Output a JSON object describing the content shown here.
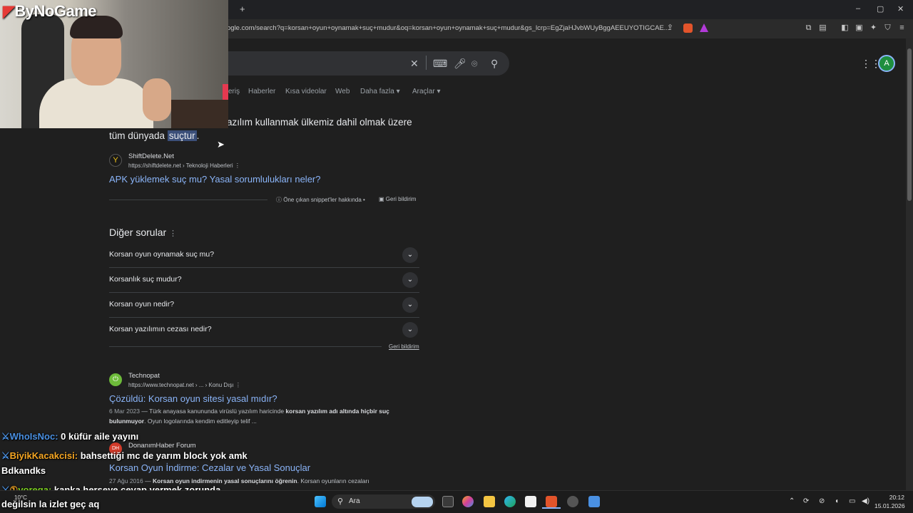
{
  "browser": {
    "new_tab": "+",
    "url": "ogle.com/search?q=korsan+oyun+oynamak+suç+mudur&oq=korsan+oyun+oynamak+suç+mudur&gs_lcrp=EgZjaHJvbWUyBggAEEUYOTIGCAE...",
    "window_controls": [
      "–",
      "▢",
      "✕"
    ]
  },
  "search": {
    "clear": "✕",
    "avatar_letter": "A"
  },
  "nav_tabs": [
    "eriş",
    "Haberler",
    "Kısa videolar",
    "Web",
    "Daha fazla",
    "Araçlar"
  ],
  "featured": {
    "line1": "azılım kullanmak ülkemiz dahil olmak üzere",
    "line2_prefix": "tüm dünyada ",
    "line2_highlight": "suçtur",
    "line2_suffix": ".",
    "source_name": "ShiftDelete.Net",
    "source_url": "https://shiftdelete.net › Teknoloji Haberleri",
    "title": "APK yüklemek suç mu? Yasal sorumlulukları neler?",
    "about": "Öne çıkan snippet'ler hakkında",
    "feedback": "Geri bildirim"
  },
  "paa": {
    "title": "Diğer sorular",
    "questions": [
      "Korsan oyun oynamak suç mu?",
      "Korsanlık suç mudur?",
      "Korsan oyun nedir?",
      "Korsan yazılımın cezası nedir?"
    ],
    "feedback": "Geri bildirim"
  },
  "results": [
    {
      "source_name": "Technopat",
      "source_url": "https://www.technopat.net › ... › Konu Dışı",
      "title": "Çözüldü: Korsan oyun sitesi yasal mıdır?",
      "date": "6 Mar 2023",
      "desc_plain": " — Türk anayasa kanununda virüslü yazılım haricinde ",
      "desc_bold": "korsan yazılım adı altında hiçbir suç bulunmuyor",
      "desc_end": ". Oyun logolarında kendim editleyip telif ..."
    },
    {
      "source_name": "DonanımHaber Forum",
      "title": "Korsan Oyun İndirme: Cezalar ve Yasal Sonuçlar",
      "date": "27 Ağu 2016",
      "desc_plain": " — ",
      "desc_bold": "Korsan oyun indirmenin yasal sonuçlarını öğrenin",
      "desc_end": ". Korsan oyunların cezaları"
    }
  ],
  "stream": {
    "logo": "ByNoGame",
    "chat": [
      {
        "user": "WhoIsNoc:",
        "user_color": "#4a90e2",
        "msg": "0 küfür aile yayını"
      },
      {
        "user": "BiyikKacakcisi:",
        "user_color": "#f5a623",
        "msg": "bahsettiği mc de yarım block yok amk"
      },
      {
        "user": "",
        "user_color": "#ffffff",
        "msg": "Bdkandks"
      },
      {
        "user": "vorega:",
        "user_color": "#7ed321",
        "msg": "kanka herseye cevap vermek zorunda"
      },
      {
        "user": "",
        "user_color": "#ffffff",
        "msg": "değilsin la izlet geç aq"
      }
    ]
  },
  "taskbar": {
    "search": "Ara",
    "time": "20:12",
    "date": "15.01.2026",
    "temp": "10°C"
  }
}
